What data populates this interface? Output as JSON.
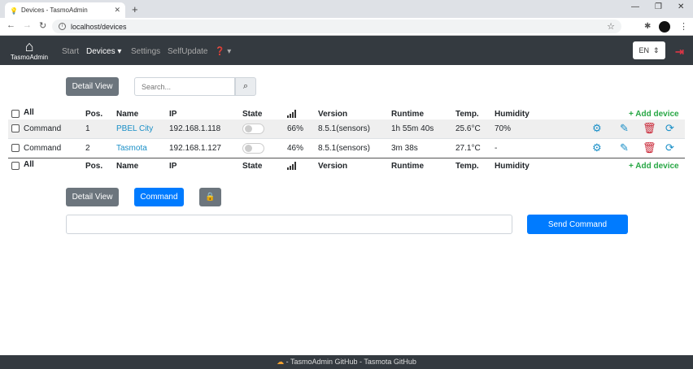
{
  "browser": {
    "tab_title": "Devices - TasmoAdmin",
    "url": "localhost/devices"
  },
  "nav": {
    "brand": "TasmoAdmin",
    "items": [
      "Start",
      "Devices",
      "Settings",
      "SelfUpdate"
    ],
    "language": "EN"
  },
  "toolbar": {
    "detail_view": "Detail View",
    "search_placeholder": "Search..."
  },
  "table": {
    "headers": {
      "all": "All",
      "pos": "Pos.",
      "name": "Name",
      "ip": "IP",
      "state": "State",
      "version": "Version",
      "runtime": "Runtime",
      "temp": "Temp.",
      "humidity": "Humidity",
      "add": "+ Add device"
    },
    "rows": [
      {
        "command": "Command",
        "pos": "1",
        "name": "PBEL City",
        "ip": "192.168.1.118",
        "signal": "66%",
        "version": "8.5.1(sensors)",
        "runtime": "1h 55m 40s",
        "temp": "25.6°C",
        "humidity": "70%"
      },
      {
        "command": "Command",
        "pos": "2",
        "name": "Tasmota",
        "ip": "192.168.1.127",
        "signal": "46%",
        "version": "8.5.1(sensors)",
        "runtime": "3m 38s",
        "temp": "27.1°C",
        "humidity": "-"
      }
    ]
  },
  "bottom": {
    "detail_view": "Detail View",
    "command": "Command",
    "send": "Send Command"
  },
  "footer": {
    "text": "- TasmoAdmin GitHub - Tasmota GitHub"
  },
  "colors": {
    "navbar": "#343a40",
    "primary": "#007bff",
    "secondary": "#6c757d",
    "success": "#28a745",
    "danger": "#c82333",
    "link": "#1a8fc7"
  }
}
